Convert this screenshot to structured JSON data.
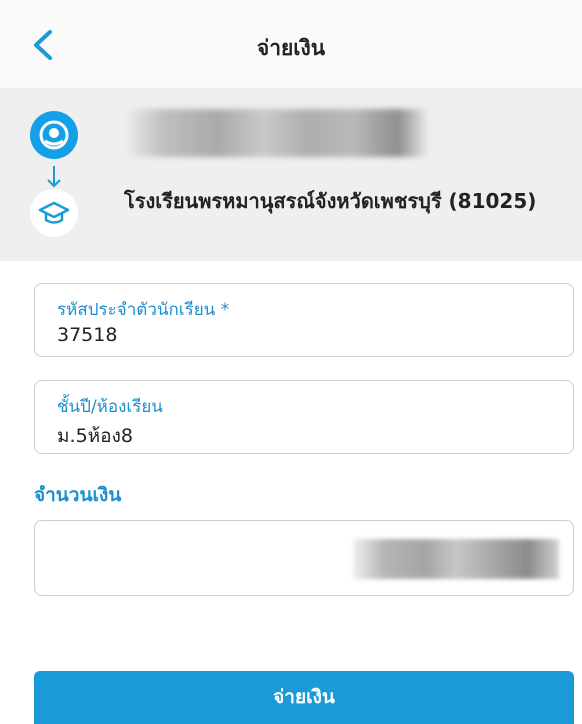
{
  "header": {
    "title": "จ่ายเงิน",
    "back_icon": "chevron-left-icon"
  },
  "account": {
    "bank_icon": "bank-logo-icon",
    "arrow_icon": "arrow-down-icon",
    "school_icon": "graduation-cap-icon",
    "school_name": "โรงเรียนพรหมานุสรณ์จังหวัดเพชรบุรี (81025)"
  },
  "form": {
    "student_id_label": "รหัสประจำตัวนักเรียน *",
    "student_id_value": "37518",
    "class_label": "ชั้นปี/ห้องเรียน",
    "class_value": "ม.5ห้อง8",
    "amount_label": "จำนวนเงิน"
  },
  "footer": {
    "pay_button": "จ่ายเงิน"
  },
  "colors": {
    "accent": "#1b9ad8",
    "label": "#1b8fd0",
    "panel_bg": "#efefef"
  }
}
